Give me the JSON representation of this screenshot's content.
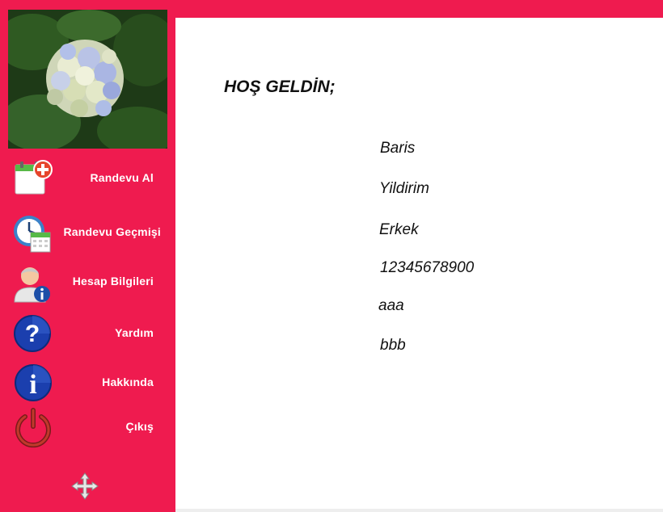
{
  "sidebar": {
    "image": "hydrangea-flower-photo",
    "items": [
      {
        "label": "Randevu Al",
        "icon": "calendar-add-icon"
      },
      {
        "label": "Randevu Geçmişi",
        "icon": "clock-calendar-icon"
      },
      {
        "label": "Hesap Bilgileri",
        "icon": "user-info-icon"
      },
      {
        "label": "Yardım",
        "icon": "help-icon"
      },
      {
        "label": "Hakkında",
        "icon": "info-icon"
      },
      {
        "label": "Çıkış",
        "icon": "power-icon"
      }
    ],
    "move_icon": "move-arrows-icon"
  },
  "main": {
    "welcome": "HOŞ GELDİN;",
    "user": {
      "first_name": "Baris",
      "last_name": "Yildirim",
      "gender": "Erkek",
      "id_number": "12345678900",
      "field_5": "aaa",
      "field_6": "bbb"
    }
  },
  "colors": {
    "accent": "#ef1b4f",
    "content_bg": "#ffffff",
    "text": "#111111",
    "sidebar_text": "#ffffff"
  }
}
